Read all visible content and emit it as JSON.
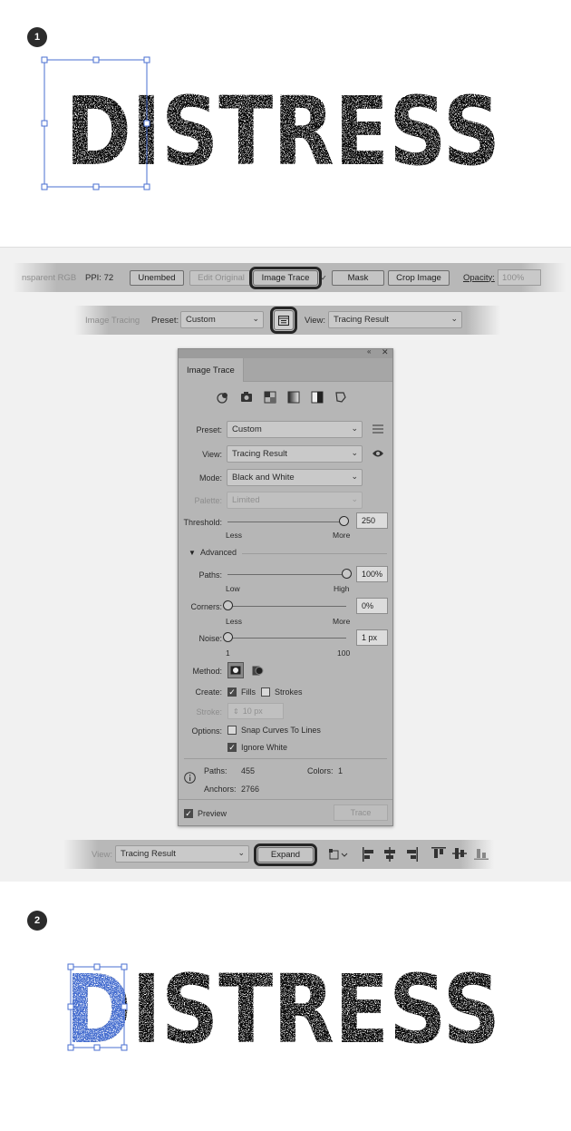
{
  "step1": {
    "badge": "1",
    "art_text": "DISTRESS"
  },
  "toolbar1": {
    "doc_info": "nsparent RGB",
    "ppi": "PPI: 72",
    "unembed": "Unembed",
    "edit_original": "Edit Original",
    "image_trace": "Image Trace",
    "mask": "Mask",
    "crop_image": "Crop Image",
    "opacity_label": "Opacity:",
    "opacity_value": "100%"
  },
  "toolbar2": {
    "label": "Image Tracing",
    "preset_label": "Preset:",
    "preset_value": "Custom",
    "view_label": "View:",
    "view_value": "Tracing Result"
  },
  "panel": {
    "title": "Image Trace",
    "preset_label": "Preset:",
    "preset_value": "Custom",
    "view_label": "View:",
    "view_value": "Tracing Result",
    "mode_label": "Mode:",
    "mode_value": "Black and White",
    "palette_label": "Palette:",
    "palette_value": "Limited",
    "threshold_label": "Threshold:",
    "threshold_value": "250",
    "threshold_fraction": 1.0,
    "threshold_min": "Less",
    "threshold_max": "More",
    "advanced_label": "Advanced",
    "paths_label": "Paths:",
    "paths_value": "100%",
    "paths_fraction": 1.0,
    "paths_min": "Low",
    "paths_max": "High",
    "corners_label": "Corners:",
    "corners_value": "0%",
    "corners_fraction": 0.0,
    "corners_min": "Less",
    "corners_max": "More",
    "noise_label": "Noise:",
    "noise_value": "1 px",
    "noise_fraction": 0.0,
    "noise_min": "1",
    "noise_max": "100",
    "method_label": "Method:",
    "create_label": "Create:",
    "fills_label": "Fills",
    "fills_checked": true,
    "strokes_label": "Strokes",
    "strokes_checked": false,
    "stroke_label": "Stroke:",
    "stroke_value": "10 px",
    "options_label": "Options:",
    "snap_label": "Snap Curves To Lines",
    "snap_checked": false,
    "ignore_white_label": "Ignore White",
    "ignore_white_checked": true,
    "paths_stat_label": "Paths:",
    "paths_stat_value": "455",
    "colors_stat_label": "Colors:",
    "colors_stat_value": "1",
    "anchors_stat_label": "Anchors:",
    "anchors_stat_value": "2766",
    "preview_label": "Preview",
    "preview_checked": true,
    "trace_button": "Trace"
  },
  "toolbar3": {
    "view_label": "View:",
    "view_value": "Tracing Result",
    "expand": "Expand"
  },
  "step2": {
    "badge": "2",
    "art_text": "DISTRESS"
  },
  "colors": {
    "selection": "#4a6fd0",
    "highlight_outline": "#262626",
    "panel_bg": "#b6b6b6"
  }
}
